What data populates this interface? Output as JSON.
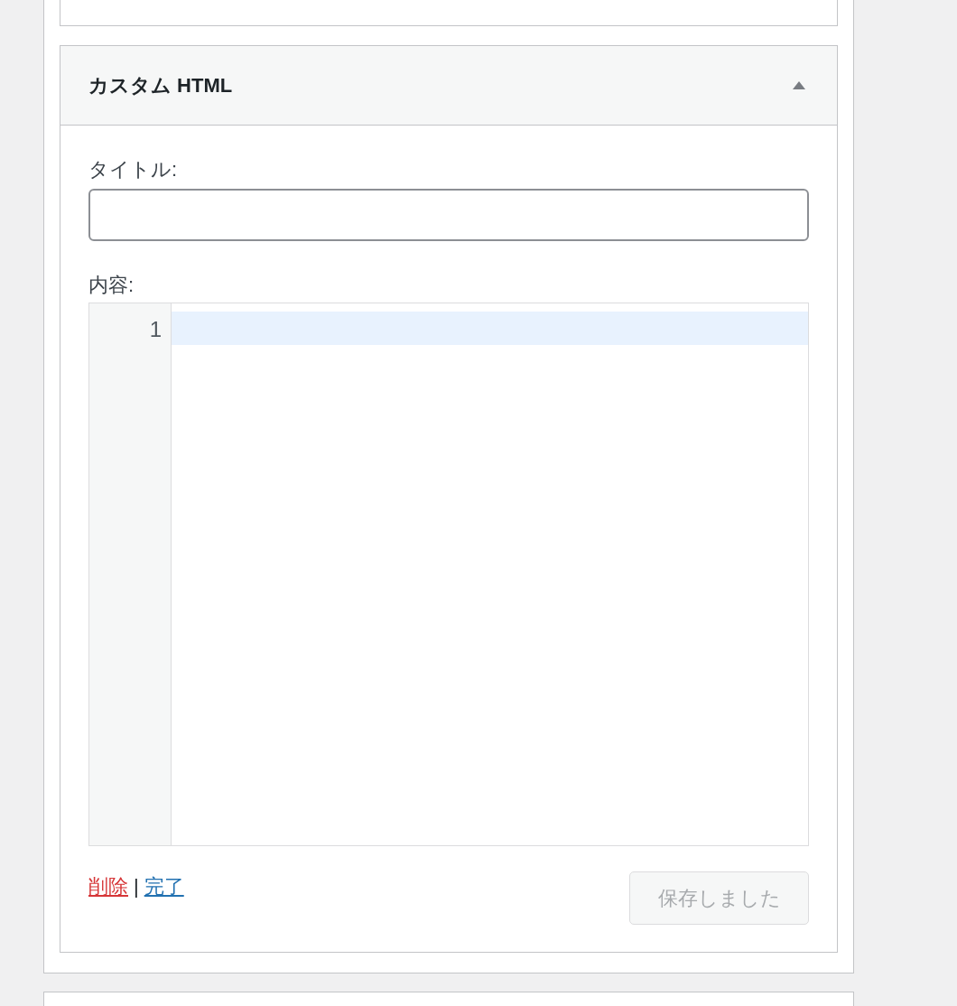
{
  "widget": {
    "title": "カスタム HTML",
    "expanded": true,
    "fields": [
      {
        "label": "タイトル:"
      }
    ],
    "content_label": "内容:",
    "editor": {
      "lines": [
        {
          "number": "1",
          "active": true
        }
      ]
    },
    "links": [
      {
        "kind": "delete",
        "label": "削除"
      },
      {
        "kind": "done",
        "label": "完了"
      }
    ],
    "separator": "|",
    "save_button": {
      "label": "保存しました",
      "disabled": true
    }
  }
}
